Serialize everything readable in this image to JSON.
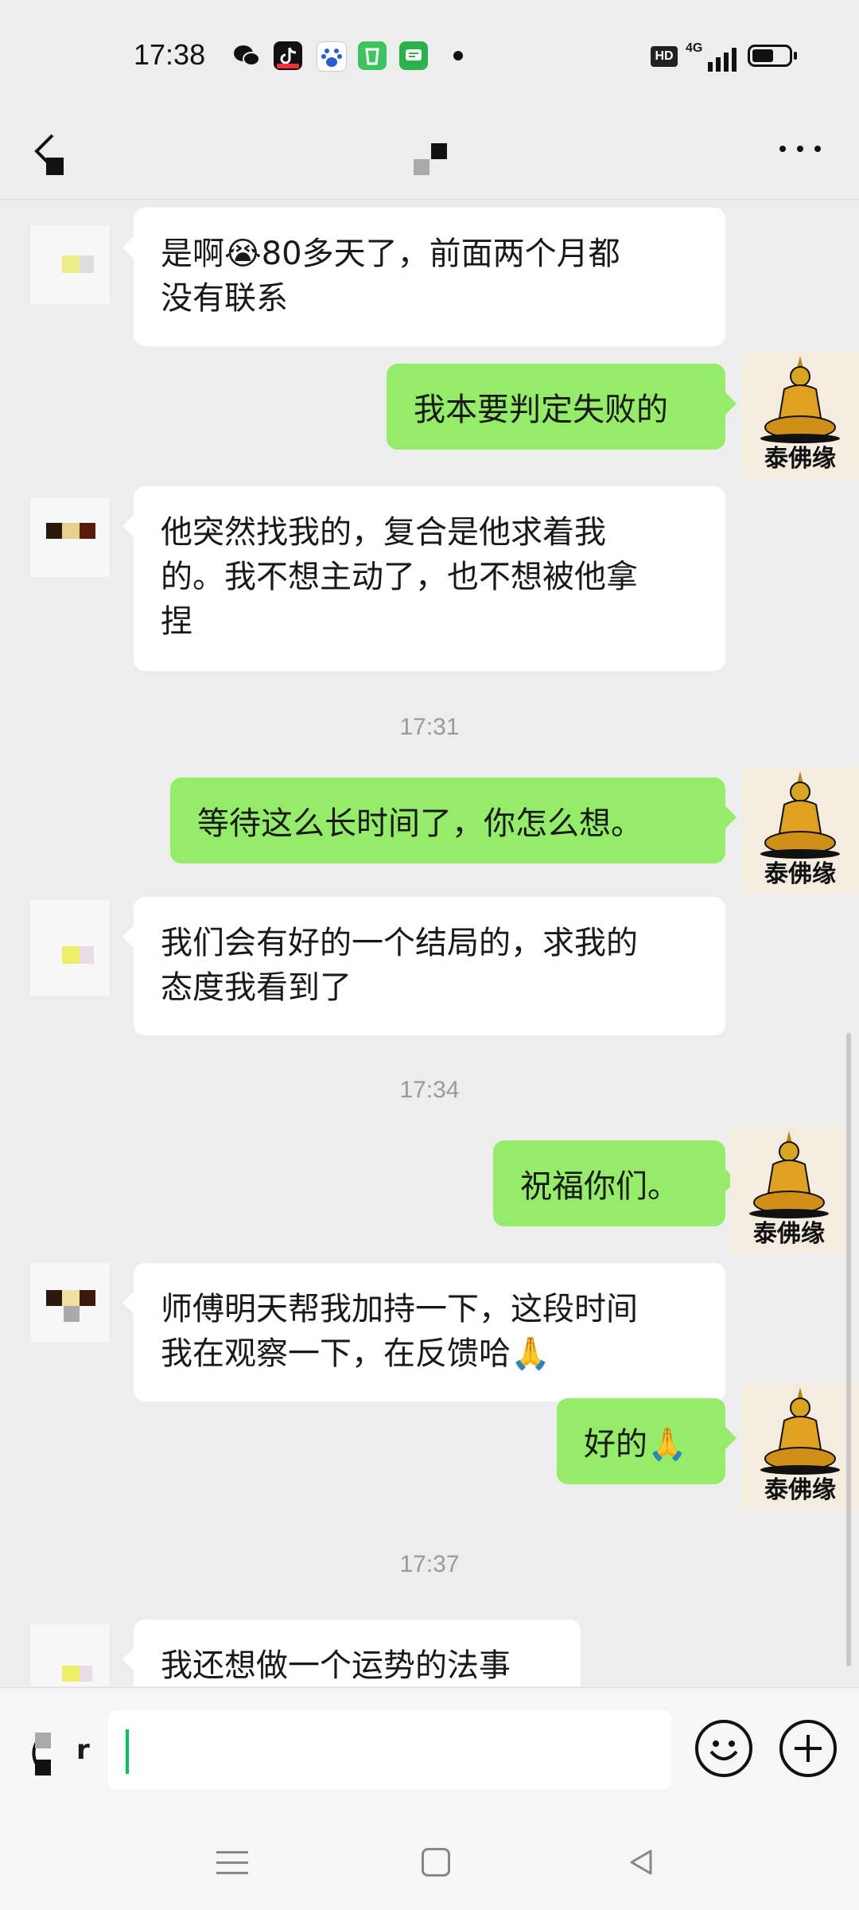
{
  "status_bar": {
    "time": "17:38",
    "hd": "HD",
    "network": "4G",
    "app_icons": [
      "wechat-icon",
      "douyin-icon",
      "baidu-icon",
      "app-green-icon",
      "messages-icon"
    ]
  },
  "title_bar": {
    "back_icon": "chevron-left-icon",
    "more_icon": "more-dots-icon"
  },
  "messages": [
    {
      "side": "in",
      "text": "是啊😭80多天了，前面两个月都\n没有联系"
    },
    {
      "side": "out",
      "text": "我本要判定失败的",
      "avatar_label": "泰佛缘"
    },
    {
      "side": "in",
      "text": "他突然找我的，复合是他求着我\n的。我不想主动了，也不想被他拿\n捏"
    },
    {
      "type": "time",
      "text": "17:31"
    },
    {
      "side": "out",
      "text": "等待这么长时间了，你怎么想。",
      "avatar_label": "泰佛缘"
    },
    {
      "side": "in",
      "text": "我们会有好的一个结局的，求我的\n态度我看到了"
    },
    {
      "type": "time",
      "text": "17:34"
    },
    {
      "side": "out",
      "text": "祝福你们。",
      "avatar_label": "泰佛缘"
    },
    {
      "side": "in",
      "text": "师傅明天帮我加持一下，这段时间\n我在观察一下，在反馈哈🙏"
    },
    {
      "side": "out",
      "text": "好的🙏",
      "avatar_label": "泰佛缘"
    },
    {
      "type": "time",
      "text": "17:37"
    },
    {
      "side": "in",
      "text": "我还想做一个运势的法事"
    }
  ],
  "input_bar": {
    "voice_partial_text": "r",
    "text_value": "",
    "emoji_icon": "emoji-smile-icon",
    "plus_icon": "plus-circle-icon"
  },
  "nav_bar": {
    "icons": [
      "menu-icon",
      "home-square-icon",
      "back-triangle-icon"
    ]
  },
  "colors": {
    "background": "#ededed",
    "outgoing_bubble": "#95ec69",
    "incoming_bubble": "#ffffff",
    "cursor": "#07c160"
  }
}
